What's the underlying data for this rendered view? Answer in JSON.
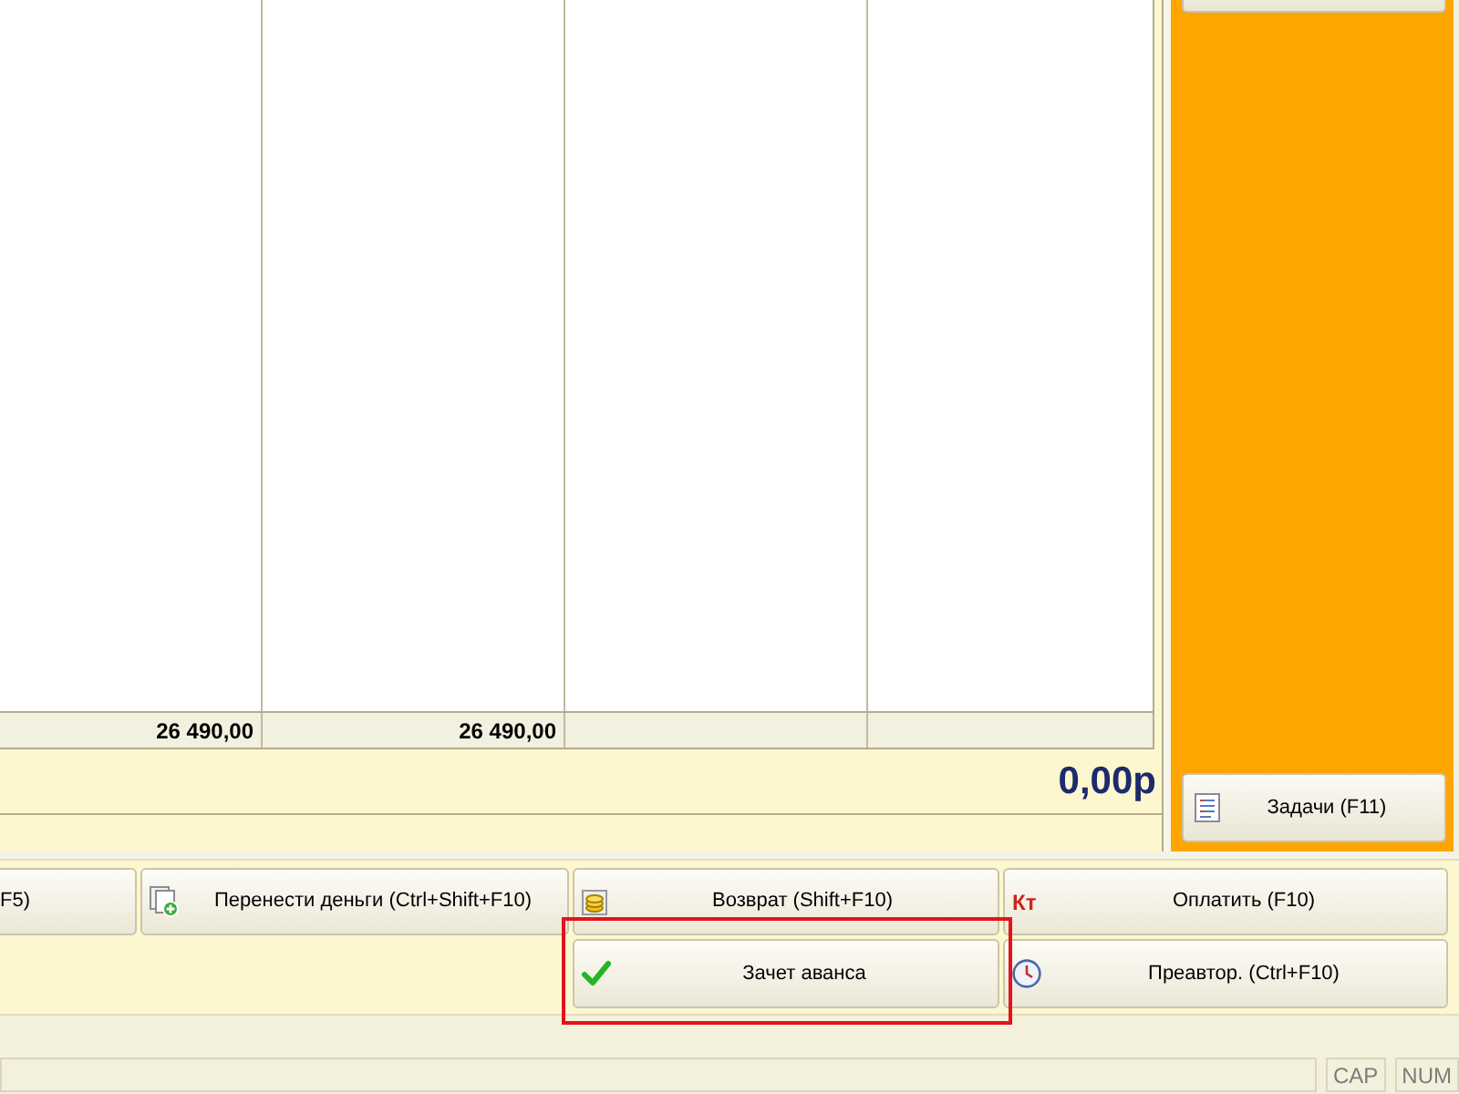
{
  "table": {
    "columns": [
      {
        "total": "26 490,00"
      },
      {
        "total": "26 490,00"
      },
      {},
      {}
    ]
  },
  "total_amount": "0,00р",
  "side_panel": {
    "buttons": [
      {
        "kind": "blank"
      },
      {
        "kind": "labeled",
        "label": "Задачи (F11)"
      }
    ]
  },
  "action_buttons": [
    {
      "label": "F5)",
      "highlighted": false
    },
    {
      "label": "Перенести деньги (Ctrl+Shift+F10)",
      "highlighted": false
    },
    {
      "label": "Возврат (Shift+F10)",
      "highlighted": false
    },
    {
      "label": "Оплатить (F10)",
      "prefix": "Кт",
      "highlighted": false
    },
    {
      "label": "Зачет аванса",
      "highlighted": true
    },
    {
      "label": "Преавтор. (Ctrl+F10)",
      "highlighted": false
    }
  ],
  "status_bar": {
    "indicators": [
      "CAP",
      "NUM"
    ]
  }
}
